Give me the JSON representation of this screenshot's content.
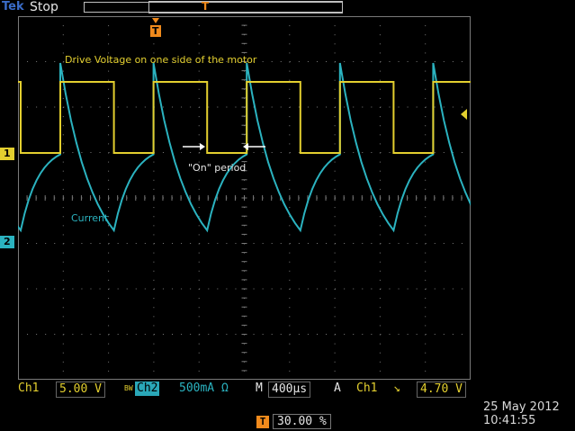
{
  "status": {
    "brand": "Tek",
    "acq_state": "Stop"
  },
  "trigger_position_marker": "T",
  "annotations": {
    "drive_voltage": "Drive Voltage on one side of the motor",
    "on_period": "\"On\" period",
    "current": "Current"
  },
  "channel_markers": {
    "ch1": "1",
    "ch2": "2"
  },
  "readouts": {
    "ch1_label": "Ch1",
    "ch1_scale": "5.00 V",
    "bw_symbol": "BW",
    "ch2_label": "Ch2",
    "ch2_scale": "500mA Ω",
    "timebase_label": "M",
    "timebase": "400µs",
    "trigger_mode": "A",
    "trigger_source": "Ch1",
    "trigger_slope": "↘",
    "trigger_level": "4.70 V",
    "trigger_position_label": "T",
    "trigger_position": "30.00 %"
  },
  "datetime": {
    "date": "25 May 2012",
    "time": "10:41:55"
  },
  "colors": {
    "ch1": "#e3cf2f",
    "ch2": "#2bb3c0",
    "trigger": "#f08a1c",
    "grid": "#7a7a7a"
  }
}
